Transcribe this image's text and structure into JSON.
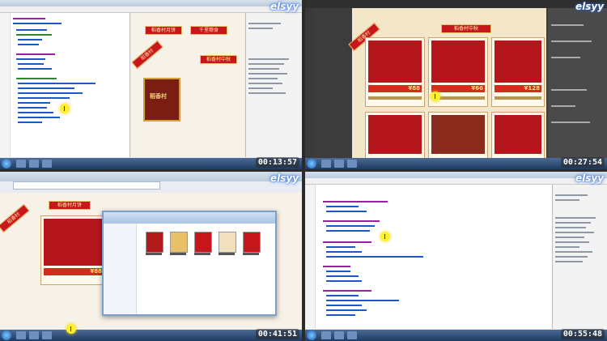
{
  "brand": {
    "logo": "elsyy"
  },
  "panels": [
    {
      "id": "p1",
      "timestamp": "00:13:57"
    },
    {
      "id": "p2",
      "timestamp": "00:27:54"
    },
    {
      "id": "p3",
      "timestamp": "00:41:51"
    },
    {
      "id": "p4",
      "timestamp": "00:55:48"
    }
  ],
  "page": {
    "banner_main": "稻香村月饼",
    "banner_alt": "千里粮食",
    "sale_banner": "稻香村中秋",
    "side_badge": "稻香村",
    "product_brand": "稻香村"
  },
  "products": [
    {
      "price": "¥88",
      "caption": "稻香村"
    },
    {
      "price": "¥66",
      "caption": "稻香村"
    },
    {
      "price": "¥128",
      "caption": "稻香村"
    }
  ],
  "colors": {
    "accent": "#c8161d",
    "gold": "#d0a040",
    "taskbar": "#1f3a60"
  }
}
